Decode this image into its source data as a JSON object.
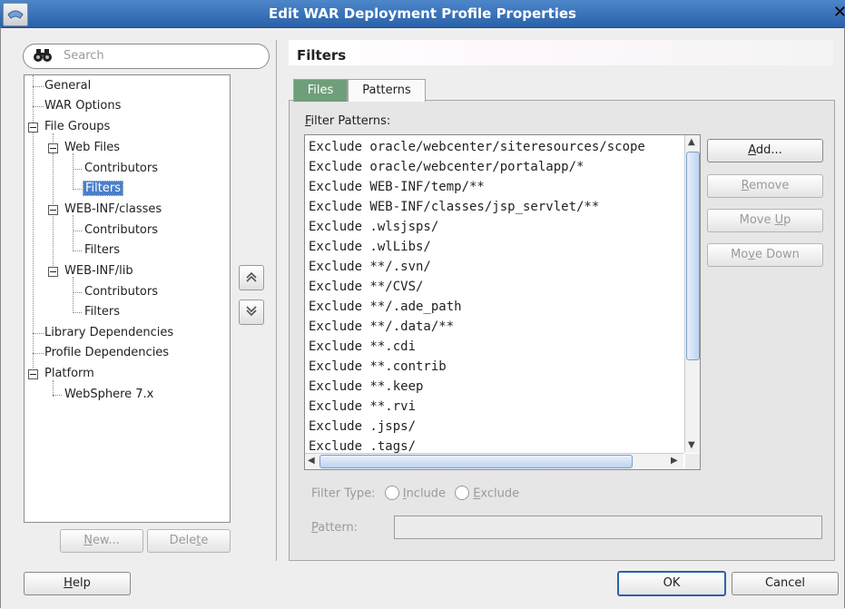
{
  "window": {
    "title": "Edit WAR Deployment Profile Properties",
    "close_glyph": "✕"
  },
  "search": {
    "placeholder": "Search"
  },
  "tree": {
    "items": [
      {
        "label": "General"
      },
      {
        "label": "WAR Options"
      },
      {
        "label": "File Groups"
      },
      {
        "label": "Web Files"
      },
      {
        "label": "Contributors"
      },
      {
        "label": "Filters",
        "selected": true
      },
      {
        "label": "WEB-INF/classes"
      },
      {
        "label": "Contributors"
      },
      {
        "label": "Filters"
      },
      {
        "label": "WEB-INF/lib"
      },
      {
        "label": "Contributors"
      },
      {
        "label": "Filters"
      },
      {
        "label": "Library Dependencies"
      },
      {
        "label": "Profile Dependencies"
      },
      {
        "label": "Platform"
      },
      {
        "label": "WebSphere 7.x"
      }
    ]
  },
  "left_buttons": {
    "new": {
      "mnemonic": "N",
      "rest": "ew..."
    },
    "delete": {
      "pre": "Dele",
      "mnemonic": "t",
      "post": "e"
    }
  },
  "panel": {
    "title": "Filters"
  },
  "tabs": [
    {
      "label": "Files"
    },
    {
      "label": "Patterns"
    }
  ],
  "filter_patterns": {
    "label_mnemonic": "F",
    "label_rest": "ilter Patterns:",
    "rows": [
      "Exclude oracle/webcenter/siteresources/scope",
      "Exclude oracle/webcenter/portalapp/*",
      "Exclude WEB-INF/temp/**",
      "Exclude WEB-INF/classes/jsp_servlet/**",
      "Exclude .wlsjsps/",
      "Exclude .wlLibs/",
      "Exclude **/.svn/",
      "Exclude **/CVS/",
      "Exclude **/.ade_path",
      "Exclude **/.data/**",
      "Exclude **.cdi",
      "Exclude **.contrib",
      "Exclude **.keep",
      "Exclude **.rvi",
      "Exclude .jsps/",
      "Exclude .tags/"
    ]
  },
  "side_buttons": {
    "add": {
      "mnemonic": "A",
      "rest": "dd..."
    },
    "remove": {
      "mnemonic": "R",
      "rest": "emove"
    },
    "move_up": {
      "pre": "Move ",
      "mnemonic": "U",
      "post": "p"
    },
    "move_down": {
      "pre": "Mo",
      "mnemonic": "v",
      "post": "e Down"
    }
  },
  "filter_type": {
    "label": "Filter Type:",
    "include": {
      "mnemonic": "I",
      "rest": "nclude"
    },
    "exclude": {
      "mnemonic": "E",
      "rest": "xclude"
    }
  },
  "pattern": {
    "mnemonic": "P",
    "rest": "attern:",
    "value": ""
  },
  "footer": {
    "help": {
      "mnemonic": "H",
      "rest": "elp"
    },
    "ok": "OK",
    "cancel": "Cancel"
  }
}
